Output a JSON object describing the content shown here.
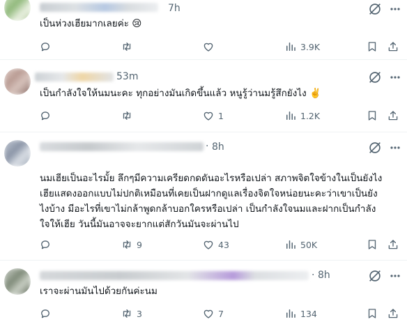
{
  "posts": [
    {
      "time": "7h",
      "text": [
        "เป็นห่วงเฮียมากเลยค่ะ 😢"
      ],
      "actions": {
        "replies": "",
        "reposts": "",
        "likes": "",
        "views": "3.9K"
      }
    },
    {
      "time": "53m",
      "text": [
        "เป็นกำลังใจให้นมนะคะ ทุกอย่างมันเกิดขึ้นแล้ว หนูรู้ว่านมรู้สึกยังไง ✌️"
      ],
      "actions": {
        "replies": "",
        "reposts": "",
        "likes": "1",
        "views": "1.2K"
      }
    },
    {
      "time": "8h",
      "text": [
        "นมเฮียเป็นอะไรมั้ย ลึกๆมีความเครียดกดดันอะไรหรือเปล่า สภาพจิตใจข้างในเป็นยังไง",
        "เฮียแสดงออกแบบไม่ปกติเหมือนที่เคยเป็นฝากดูแลเรื่องจิตใจหน่อยนะคะว่าเขาเป็นยัง",
        "ไงบ้าง มีอะไรที่เขาไม่กล้าพูดกล้าบอกใครหรือเปล่า เป็นกำลังใจนมและฝากเป็นกำลัง",
        "ใจให้เฮีย วันนี้มันอาจจะยากแต่สักวันมันจะผ่านไป"
      ],
      "actions": {
        "replies": "",
        "reposts": "9",
        "likes": "43",
        "views": "50K"
      }
    },
    {
      "time": "8h",
      "text": [
        "เราจะผ่านมันไปด้วยกันค่ะนม"
      ],
      "actions": {
        "replies": "",
        "reposts": "3",
        "likes": "7",
        "views": "134"
      }
    }
  ],
  "colors": {
    "text": "#0f1419",
    "muted": "#536471",
    "divider": "#eff3f4"
  },
  "icons": [
    "reply-icon",
    "repost-icon",
    "like-icon",
    "views-icon",
    "bookmark-icon",
    "share-icon",
    "grok-icon",
    "more-icon"
  ]
}
